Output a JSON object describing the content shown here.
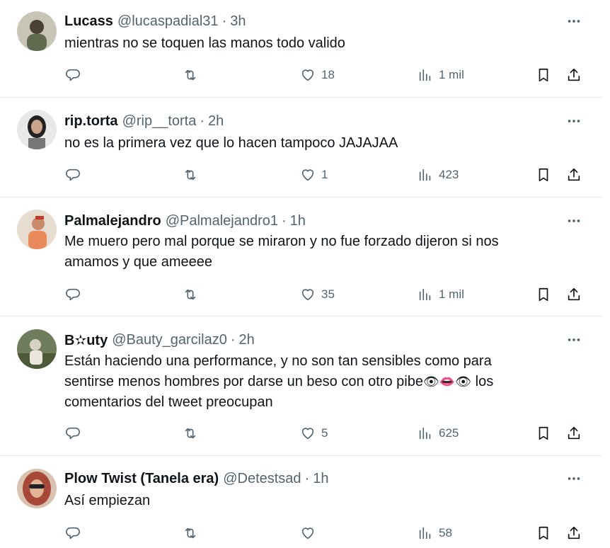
{
  "tweets": [
    {
      "name": "Lucass",
      "handle": "@lucaspadial31",
      "time": "3h",
      "text": "mientras no se toquen las manos todo valido",
      "replies": "",
      "retweets": "",
      "likes": "18",
      "views": "1 mil",
      "avatar_color": "#6b6b5a"
    },
    {
      "name": "rip.torta",
      "handle": "@rip__torta",
      "time": "2h",
      "text": "no es la primera vez que lo hacen tampoco JAJAJAA",
      "replies": "",
      "retweets": "",
      "likes": "1",
      "views": "423",
      "avatar_color": "#9a9a9a"
    },
    {
      "name": "Palmalejandro",
      "handle": "@Palmalejandro1",
      "time": "1h",
      "text_lines": [
        "Me muero pero mal porque se miraron y no fue forzado dijeron si nos",
        "amamos y que ameeee"
      ],
      "replies": "",
      "retweets": "",
      "likes": "35",
      "views": "1 mil",
      "avatar_color": "#d9a37a"
    },
    {
      "name": "B✫uty",
      "handle": "@Bauty_garcilaz0",
      "time": "2h",
      "text_lines": [
        "Están haciendo una performance, y no son tan sensibles como para",
        "sentirse menos hombres por darse un beso con otro pibe",
        "los",
        "comentarios del tweet preocupan"
      ],
      "emojis": "👁👄👁",
      "replies": "",
      "retweets": "",
      "likes": "5",
      "views": "625",
      "avatar_color": "#7a8a6a"
    },
    {
      "name": "Plow Twist (Tanela era)",
      "handle": "@Detestsad",
      "time": "1h",
      "text": "Así empiezan",
      "replies": "",
      "retweets": "",
      "likes": "",
      "views": "58",
      "avatar_color": "#b46a5a"
    }
  ],
  "separator": "·",
  "icons": {
    "more": "more-dots-icon",
    "reply": "reply-icon",
    "retweet": "retweet-icon",
    "like": "heart-icon",
    "views": "views-icon",
    "bookmark": "bookmark-icon",
    "share": "share-icon"
  },
  "colors": {
    "text": "#0f1419",
    "muted": "#536471",
    "border": "#e7e9ea"
  }
}
